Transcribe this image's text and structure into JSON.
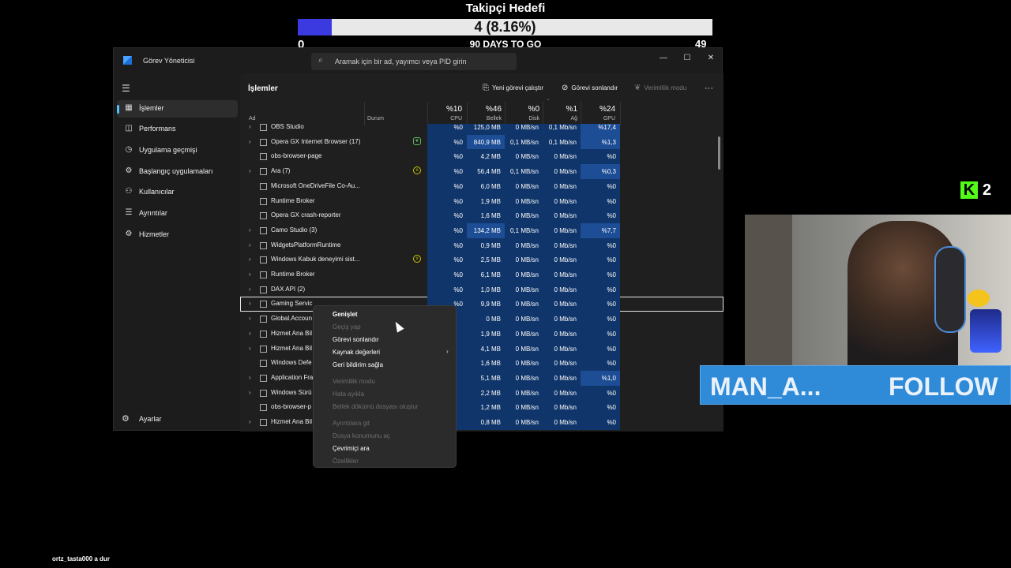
{
  "goal": {
    "title": "Takipçi Hedefi",
    "current": "4 (8.16%)",
    "progress_fraction": 0.0816,
    "min": "0",
    "max": "49",
    "days": "90 DAYS TO GO",
    "fill_color": "#3a3ae0"
  },
  "window": {
    "title": "Görev Yöneticisi",
    "search_placeholder": "Aramak için bir ad, yayımcı veya PID girin",
    "controls": {
      "minimize": "—",
      "maximize": "☐",
      "close": "✕"
    }
  },
  "nav": {
    "items": [
      {
        "label": "İşlemler",
        "icon": "grid-icon"
      },
      {
        "label": "Performans",
        "icon": "performance-icon"
      },
      {
        "label": "Uygulama geçmişi",
        "icon": "history-icon"
      },
      {
        "label": "Başlangıç uygulamaları",
        "icon": "startup-icon"
      },
      {
        "label": "Kullanıcılar",
        "icon": "users-icon"
      },
      {
        "label": "Ayrıntılar",
        "icon": "details-icon"
      },
      {
        "label": "Hizmetler",
        "icon": "services-icon"
      }
    ],
    "settings": "Ayarlar"
  },
  "toolbar": {
    "page_title": "İşlemler",
    "run_task": "Yeni görevi çalıştır",
    "end_task": "Görevi sonlandır",
    "efficiency": "Verimlilik modu",
    "more": "···"
  },
  "columns": {
    "name": "Ad",
    "status": "Durum",
    "cpu_pct": "%10",
    "cpu": "CPU",
    "mem_pct": "%46",
    "mem": "Bellek",
    "disk_pct": "%0",
    "disk": "Disk",
    "net_pct": "%1",
    "net": "Ağ",
    "gpu_pct": "%24",
    "gpu": "GPU"
  },
  "rows": [
    {
      "name": "OBS Studio",
      "exp": "›",
      "status": "",
      "cpu": "%0",
      "mem": "125,0 MB",
      "disk": "0 MB/sn",
      "net": "0,1 Mb/sn",
      "gpu": "%17,4"
    },
    {
      "name": "Opera GX Internet Browser (17)",
      "exp": "›",
      "status": "eco",
      "cpu": "%0",
      "mem": "840,9 MB",
      "disk": "0,1 MB/sn",
      "net": "0,1 Mb/sn",
      "gpu": "%1,3"
    },
    {
      "name": "obs-browser-page",
      "exp": "",
      "status": "",
      "cpu": "%0",
      "mem": "4,2 MB",
      "disk": "0 MB/sn",
      "net": "0 Mb/sn",
      "gpu": "%0"
    },
    {
      "name": "Ara (7)",
      "exp": "›",
      "status": "pause",
      "cpu": "%0",
      "mem": "56,4 MB",
      "disk": "0,1 MB/sn",
      "net": "0 Mb/sn",
      "gpu": "%0,3"
    },
    {
      "name": "Microsoft OneDriveFile Co-Au...",
      "exp": "",
      "status": "",
      "cpu": "%0",
      "mem": "6,0 MB",
      "disk": "0 MB/sn",
      "net": "0 Mb/sn",
      "gpu": "%0"
    },
    {
      "name": "Runtime Broker",
      "exp": "",
      "status": "",
      "cpu": "%0",
      "mem": "1,9 MB",
      "disk": "0 MB/sn",
      "net": "0 Mb/sn",
      "gpu": "%0"
    },
    {
      "name": "Opera GX crash-reporter",
      "exp": "",
      "status": "",
      "cpu": "%0",
      "mem": "1,6 MB",
      "disk": "0 MB/sn",
      "net": "0 Mb/sn",
      "gpu": "%0"
    },
    {
      "name": "Camo Studio (3)",
      "exp": "›",
      "status": "",
      "cpu": "%0",
      "mem": "134,2 MB",
      "disk": "0,1 MB/sn",
      "net": "0 Mb/sn",
      "gpu": "%7,7"
    },
    {
      "name": "WidgetsPlatformRuntime",
      "exp": "›",
      "status": "",
      "cpu": "%0",
      "mem": "0,9 MB",
      "disk": "0 MB/sn",
      "net": "0 Mb/sn",
      "gpu": "%0"
    },
    {
      "name": "Windows Kabuk deneyimi sist...",
      "exp": "›",
      "status": "pause",
      "cpu": "%0",
      "mem": "2,5 MB",
      "disk": "0 MB/sn",
      "net": "0 Mb/sn",
      "gpu": "%0"
    },
    {
      "name": "Runtime Broker",
      "exp": "›",
      "status": "",
      "cpu": "%0",
      "mem": "6,1 MB",
      "disk": "0 MB/sn",
      "net": "0 Mb/sn",
      "gpu": "%0"
    },
    {
      "name": "DAX API (2)",
      "exp": "›",
      "status": "",
      "cpu": "%0",
      "mem": "1,0 MB",
      "disk": "0 MB/sn",
      "net": "0 Mb/sn",
      "gpu": "%0"
    },
    {
      "name": "Gaming Servic",
      "exp": "›",
      "status": "",
      "cpu": "%0",
      "mem": "9,9 MB",
      "disk": "0 MB/sn",
      "net": "0 Mb/sn",
      "gpu": "%0"
    },
    {
      "name": "Global.Accoun",
      "exp": "›",
      "status": "",
      "cpu": "",
      "mem": "0 MB",
      "disk": "0 MB/sn",
      "net": "0 Mb/sn",
      "gpu": "%0"
    },
    {
      "name": "Hizmet Ana Bil",
      "exp": "›",
      "status": "",
      "cpu": "",
      "mem": "1,9 MB",
      "disk": "0 MB/sn",
      "net": "0 Mb/sn",
      "gpu": "%0"
    },
    {
      "name": "Hizmet Ana Bil",
      "exp": "›",
      "status": "",
      "cpu": "",
      "mem": "4,1 MB",
      "disk": "0 MB/sn",
      "net": "0 Mb/sn",
      "gpu": "%0"
    },
    {
      "name": "Windows Defe",
      "exp": "",
      "status": "",
      "cpu": "",
      "mem": "1,6 MB",
      "disk": "0 MB/sn",
      "net": "0 Mb/sn",
      "gpu": "%0"
    },
    {
      "name": "Application Fra",
      "exp": "›",
      "status": "",
      "cpu": "",
      "mem": "5,1 MB",
      "disk": "0 MB/sn",
      "net": "0 Mb/sn",
      "gpu": "%1,0"
    },
    {
      "name": "Windows Sürü",
      "exp": "›",
      "status": "",
      "cpu": "",
      "mem": "2,2 MB",
      "disk": "0 MB/sn",
      "net": "0 Mb/sn",
      "gpu": "%0"
    },
    {
      "name": "obs-browser-p",
      "exp": "",
      "status": "",
      "cpu": "",
      "mem": "1,2 MB",
      "disk": "0 MB/sn",
      "net": "0 Mb/sn",
      "gpu": "%0"
    },
    {
      "name": "Hizmet Ana Bil",
      "exp": "›",
      "status": "",
      "cpu": "",
      "mem": "0,8 MB",
      "disk": "0 MB/sn",
      "net": "0 Mb/sn",
      "gpu": "%0"
    }
  ],
  "context_menu": {
    "expand": "Genişlet",
    "switch_to": "Geçiş yap",
    "end_task": "Görevi sonlandır",
    "resource_values": "Kaynak değerleri",
    "feedback": "Geri bildirim sağla",
    "efficiency": "Verimlilik modu",
    "debug": "Hata ayıkla",
    "dump": "Bellek dökümü dosyası oluştur",
    "details": "Ayrıntılara git",
    "open_location": "Dosya konumunu aç",
    "search_online": "Çevrimiçi ara",
    "properties": "Özellikler"
  },
  "kick": {
    "logo": "K",
    "count": "2"
  },
  "follow_banner": {
    "name": "MAN_A...",
    "action": "FOLLOW"
  },
  "chat": {
    "user": "ortz_tasta000",
    "message": "a dur"
  }
}
